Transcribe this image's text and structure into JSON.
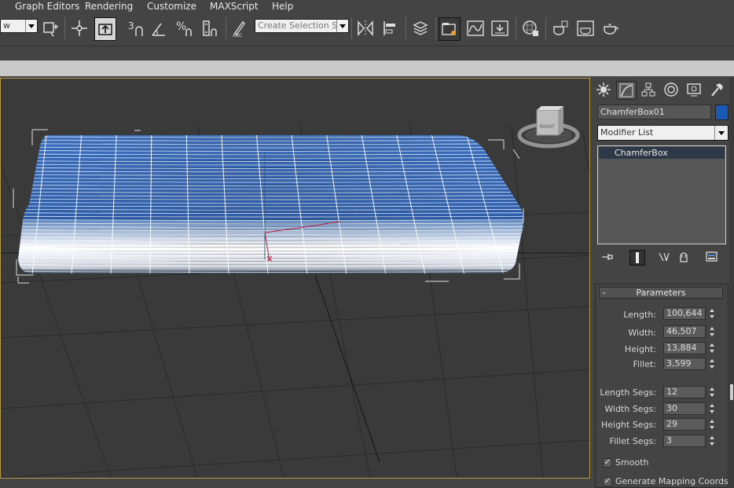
{
  "menu": {
    "items": [
      "Graph Editors",
      "Rendering",
      "Customize",
      "MAXScript",
      "Help"
    ]
  },
  "toolbar": {
    "view_dropdown": "w",
    "selection_set_placeholder": "Create Selection Se",
    "icons": [
      "select-and-link-icon",
      "transform-gizmo-icon",
      "select-object-icon",
      "snap-3d-icon",
      "angle-snap-icon",
      "percent-snap-icon",
      "spinner-snap-icon",
      "edit-named-selection-icon",
      "mirror-icon",
      "align-icon",
      "layer-manager-icon",
      "scene-explorer-icon",
      "curve-editor-icon",
      "schematic-view-icon",
      "material-editor-icon",
      "render-setup-icon",
      "rendered-frame-window-icon",
      "render-production-icon"
    ]
  },
  "viewport": {
    "viewcube_label": "RIGHT",
    "wireframe_color": "#ffffff",
    "box_color": "#2a5ea8"
  },
  "command_panel": {
    "object_name": "ChamferBox01",
    "object_color": "#1a5ab4",
    "modifier_list_label": "Modifier List",
    "stack": [
      "ChamferBox"
    ],
    "rollout": {
      "collapse_symbol": "-",
      "title": "Parameters",
      "params": [
        {
          "label": "Length:",
          "value": "100,644"
        },
        {
          "label": "Width:",
          "value": "46,507"
        },
        {
          "label": "Height:",
          "value": "13,884"
        },
        {
          "label": "Fillet:",
          "value": "3,599"
        },
        {
          "label": "Length Segs:",
          "value": "12"
        },
        {
          "label": "Width Segs:",
          "value": "30"
        },
        {
          "label": "Height Segs:",
          "value": "29"
        },
        {
          "label": "Fillet Segs:",
          "value": "3"
        }
      ],
      "checkboxes": [
        {
          "label": "Smooth",
          "checked": true
        },
        {
          "label": "Generate Mapping Coords.",
          "checked": true
        }
      ]
    }
  }
}
